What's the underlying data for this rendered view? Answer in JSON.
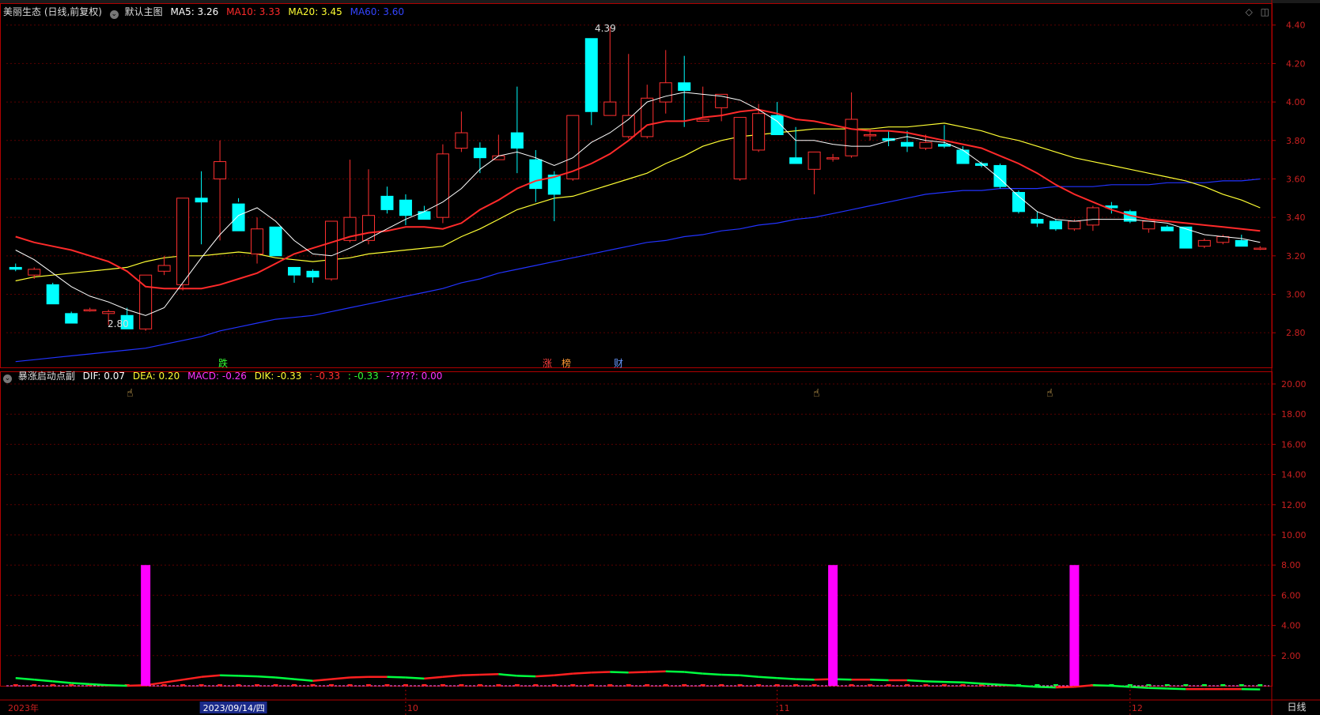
{
  "main_legend": {
    "title": "美丽生态 (日线,前复权)",
    "template": "默认主图",
    "ma5": {
      "label": "MA5: 3.26",
      "color": "#ffffff"
    },
    "ma10": {
      "label": "MA10: 3.33",
      "color": "#ff2a2a"
    },
    "ma20": {
      "label": "MA20: 3.45",
      "color": "#ffff33"
    },
    "ma60": {
      "label": "MA60: 3.60",
      "color": "#2233ff"
    }
  },
  "indicator_legend": {
    "name": "暴涨启动点副",
    "dif": "DIF: 0.07",
    "dea": "DEA: 0.20",
    "macd": "MACD: -0.26",
    "dik": "DIK: -0.33",
    "dik2": ": -0.33",
    "dik3": ": -0.33",
    "unk": "-?????: 0.00"
  },
  "markers": {
    "fall": "跌",
    "rise": "涨",
    "list": "榜",
    "finance": "财"
  },
  "annotations": {
    "high": "4.39",
    "low": "2.80"
  },
  "period_button": "日线",
  "colors": {
    "up": "#ff3030",
    "down": "#00ffff",
    "grid": "#5a0000",
    "axis": "#b00000",
    "signal": "#ff00ff"
  },
  "price_axis": {
    "ticks": [
      "4.40",
      "4.20",
      "4.00",
      "3.80",
      "3.60",
      "3.40",
      "3.20",
      "3.00",
      "2.80"
    ],
    "min": 2.62,
    "max": 4.44
  },
  "indicator_axis": {
    "ticks": [
      "20.00",
      "18.00",
      "16.00",
      "14.00",
      "12.00",
      "10.00",
      "8.00",
      "6.00",
      "4.00",
      "2.00"
    ],
    "min": 0,
    "max": 20
  },
  "time_axis": {
    "labels": [
      "2023年",
      "2023/09/14/四",
      "10",
      "11",
      "12"
    ]
  },
  "chart_data": {
    "type": "candlestick",
    "ohlc": [
      [
        3.14,
        3.16,
        3.12,
        3.13
      ],
      [
        3.1,
        3.14,
        3.08,
        3.13
      ],
      [
        3.05,
        3.06,
        2.96,
        2.95
      ],
      [
        2.9,
        2.91,
        2.86,
        2.85
      ],
      [
        2.92,
        2.93,
        2.91,
        2.92
      ],
      [
        2.9,
        2.92,
        2.84,
        2.91
      ],
      [
        2.89,
        2.93,
        2.82,
        2.82
      ],
      [
        2.82,
        3.1,
        2.81,
        3.1
      ],
      [
        3.12,
        3.2,
        3.1,
        3.15
      ],
      [
        3.05,
        3.5,
        3.02,
        3.5
      ],
      [
        3.5,
        3.64,
        3.26,
        3.48
      ],
      [
        3.6,
        3.8,
        3.28,
        3.69
      ],
      [
        3.47,
        3.5,
        3.48,
        3.33
      ],
      [
        3.21,
        3.4,
        3.16,
        3.34
      ],
      [
        3.35,
        3.35,
        3.2,
        3.2
      ],
      [
        3.14,
        3.14,
        3.06,
        3.1
      ],
      [
        3.12,
        3.13,
        3.06,
        3.09
      ],
      [
        3.08,
        3.38,
        3.07,
        3.38
      ],
      [
        3.28,
        3.7,
        3.27,
        3.4
      ],
      [
        3.28,
        3.65,
        3.26,
        3.41
      ],
      [
        3.51,
        3.56,
        3.42,
        3.44
      ],
      [
        3.49,
        3.52,
        3.36,
        3.41
      ],
      [
        3.43,
        3.46,
        3.39,
        3.39
      ],
      [
        3.4,
        3.78,
        3.37,
        3.73
      ],
      [
        3.76,
        3.95,
        3.74,
        3.84
      ],
      [
        3.76,
        3.79,
        3.63,
        3.71
      ],
      [
        3.7,
        3.83,
        3.7,
        3.72
      ],
      [
        3.84,
        4.08,
        3.63,
        3.76
      ],
      [
        3.7,
        3.75,
        3.48,
        3.55
      ],
      [
        3.62,
        3.64,
        3.38,
        3.52
      ],
      [
        3.6,
        3.92,
        3.59,
        3.93
      ],
      [
        4.33,
        4.33,
        3.88,
        3.95
      ],
      [
        3.93,
        4.39,
        3.99,
        4.0
      ],
      [
        3.82,
        4.25,
        3.81,
        3.93
      ],
      [
        3.82,
        4.09,
        3.81,
        4.02
      ],
      [
        4.0,
        4.27,
        3.94,
        4.1
      ],
      [
        4.1,
        4.24,
        3.87,
        4.06
      ],
      [
        3.9,
        4.08,
        3.92,
        3.91
      ],
      [
        3.97,
        4.03,
        3.9,
        4.04
      ],
      [
        3.6,
        3.89,
        3.59,
        3.92
      ],
      [
        3.75,
        3.99,
        3.74,
        3.94
      ],
      [
        3.93,
        4.0,
        3.86,
        3.83
      ],
      [
        3.71,
        3.87,
        3.68,
        3.68
      ],
      [
        3.65,
        3.72,
        3.52,
        3.74
      ],
      [
        3.71,
        3.73,
        3.69,
        3.71
      ],
      [
        3.72,
        4.05,
        3.71,
        3.91
      ],
      [
        3.83,
        3.86,
        3.8,
        3.83
      ],
      [
        3.81,
        3.85,
        3.77,
        3.8
      ],
      [
        3.79,
        3.85,
        3.74,
        3.77
      ],
      [
        3.76,
        3.83,
        3.75,
        3.79
      ],
      [
        3.78,
        3.88,
        3.76,
        3.77
      ],
      [
        3.75,
        3.77,
        3.68,
        3.68
      ],
      [
        3.68,
        3.69,
        3.66,
        3.67
      ],
      [
        3.67,
        3.68,
        3.55,
        3.56
      ],
      [
        3.53,
        3.54,
        3.42,
        3.43
      ],
      [
        3.39,
        3.43,
        3.35,
        3.37
      ],
      [
        3.38,
        3.39,
        3.33,
        3.34
      ],
      [
        3.34,
        3.39,
        3.33,
        3.38
      ],
      [
        3.36,
        3.46,
        3.33,
        3.45
      ],
      [
        3.46,
        3.48,
        3.42,
        3.45
      ],
      [
        3.43,
        3.44,
        3.37,
        3.38
      ],
      [
        3.34,
        3.38,
        3.32,
        3.38
      ],
      [
        3.35,
        3.36,
        3.33,
        3.33
      ],
      [
        3.35,
        3.35,
        3.24,
        3.24
      ],
      [
        3.25,
        3.29,
        3.24,
        3.28
      ],
      [
        3.27,
        3.31,
        3.26,
        3.3
      ],
      [
        3.28,
        3.31,
        3.25,
        3.25
      ],
      [
        3.24,
        3.25,
        3.23,
        3.24
      ]
    ],
    "ma5": [
      3.23,
      3.18,
      3.11,
      3.04,
      2.99,
      2.96,
      2.92,
      2.89,
      2.93,
      3.06,
      3.19,
      3.31,
      3.41,
      3.45,
      3.38,
      3.28,
      3.21,
      3.2,
      3.24,
      3.29,
      3.34,
      3.39,
      3.43,
      3.48,
      3.55,
      3.65,
      3.72,
      3.74,
      3.71,
      3.67,
      3.71,
      3.79,
      3.84,
      3.91,
      4.0,
      4.03,
      4.05,
      4.04,
      4.03,
      4.01,
      3.96,
      3.9,
      3.8,
      3.8,
      3.78,
      3.77,
      3.77,
      3.8,
      3.82,
      3.8,
      3.79,
      3.75,
      3.68,
      3.6,
      3.51,
      3.43,
      3.39,
      3.38,
      3.39,
      3.39,
      3.39,
      3.38,
      3.37,
      3.34,
      3.31,
      3.3,
      3.29,
      3.27
    ],
    "ma10": [
      3.3,
      3.27,
      3.25,
      3.23,
      3.2,
      3.17,
      3.12,
      3.04,
      3.03,
      3.03,
      3.03,
      3.05,
      3.08,
      3.11,
      3.16,
      3.21,
      3.24,
      3.27,
      3.3,
      3.32,
      3.33,
      3.35,
      3.35,
      3.34,
      3.37,
      3.44,
      3.49,
      3.55,
      3.59,
      3.61,
      3.64,
      3.68,
      3.73,
      3.8,
      3.88,
      3.9,
      3.9,
      3.92,
      3.93,
      3.95,
      3.96,
      3.94,
      3.91,
      3.9,
      3.88,
      3.86,
      3.85,
      3.85,
      3.84,
      3.82,
      3.8,
      3.78,
      3.76,
      3.72,
      3.68,
      3.63,
      3.57,
      3.52,
      3.48,
      3.44,
      3.41,
      3.39,
      3.38,
      3.37,
      3.36,
      3.35,
      3.34,
      3.33
    ],
    "ma20": [
      3.07,
      3.09,
      3.1,
      3.11,
      3.12,
      3.13,
      3.14,
      3.17,
      3.19,
      3.2,
      3.2,
      3.21,
      3.22,
      3.21,
      3.19,
      3.18,
      3.17,
      3.18,
      3.19,
      3.21,
      3.22,
      3.23,
      3.24,
      3.25,
      3.3,
      3.34,
      3.39,
      3.44,
      3.47,
      3.5,
      3.51,
      3.54,
      3.57,
      3.6,
      3.63,
      3.68,
      3.72,
      3.77,
      3.8,
      3.82,
      3.83,
      3.84,
      3.85,
      3.86,
      3.86,
      3.86,
      3.86,
      3.87,
      3.87,
      3.88,
      3.89,
      3.87,
      3.85,
      3.82,
      3.8,
      3.77,
      3.74,
      3.71,
      3.69,
      3.67,
      3.65,
      3.63,
      3.61,
      3.59,
      3.56,
      3.52,
      3.49,
      3.45
    ],
    "ma60": [
      2.65,
      2.66,
      2.67,
      2.68,
      2.69,
      2.7,
      2.71,
      2.72,
      2.74,
      2.76,
      2.78,
      2.81,
      2.83,
      2.85,
      2.87,
      2.88,
      2.89,
      2.91,
      2.93,
      2.95,
      2.97,
      2.99,
      3.01,
      3.03,
      3.06,
      3.08,
      3.11,
      3.13,
      3.15,
      3.17,
      3.19,
      3.21,
      3.23,
      3.25,
      3.27,
      3.28,
      3.3,
      3.31,
      3.33,
      3.34,
      3.36,
      3.37,
      3.39,
      3.4,
      3.42,
      3.44,
      3.46,
      3.48,
      3.5,
      3.52,
      3.53,
      3.54,
      3.54,
      3.55,
      3.55,
      3.55,
      3.56,
      3.56,
      3.56,
      3.57,
      3.57,
      3.57,
      3.58,
      3.58,
      3.58,
      3.59,
      3.59,
      3.6
    ],
    "signal_bars": [
      {
        "index": 7,
        "value": 8
      },
      {
        "index": 44,
        "value": 8
      },
      {
        "index": 57,
        "value": 8
      }
    ],
    "indicator_line": [
      0.7,
      0.55,
      0.4,
      0.25,
      0.15,
      0.05,
      0.0,
      0.05,
      0.3,
      0.55,
      0.8,
      0.95,
      0.9,
      0.85,
      0.75,
      0.6,
      0.45,
      0.6,
      0.75,
      0.8,
      0.8,
      0.75,
      0.65,
      0.8,
      0.95,
      1.0,
      1.05,
      0.9,
      0.85,
      0.95,
      1.1,
      1.2,
      1.25,
      1.2,
      1.25,
      1.3,
      1.25,
      1.1,
      1.0,
      0.95,
      0.8,
      0.7,
      0.6,
      0.55,
      0.6,
      0.55,
      0.55,
      0.5,
      0.5,
      0.4,
      0.35,
      0.3,
      0.2,
      0.1,
      0.0,
      -0.1,
      -0.15,
      -0.1,
      0.05,
      0.0,
      -0.1,
      -0.2,
      -0.25,
      -0.3,
      -0.3,
      -0.3,
      -0.3,
      -0.33
    ],
    "macd_bars": [
      0.1,
      0.15,
      0.12,
      0.08,
      0.05,
      0.03,
      0.01,
      0.02,
      0.05,
      0.08,
      0.12,
      0.15,
      0.18,
      0.14,
      0.1,
      0.06,
      0.12,
      0.16,
      0.2,
      0.22,
      0.22,
      0.2,
      0.18,
      0.22,
      0.24,
      0.25,
      0.26,
      0.24,
      0.18,
      0.2,
      0.22,
      0.26,
      0.3,
      0.28,
      0.27,
      0.26,
      0.22,
      0.2,
      0.18,
      0.15,
      0.12,
      0.1,
      0.08,
      0.06,
      0.1,
      0.12,
      0.15,
      0.2,
      0.18,
      0.15,
      0.12,
      0.08,
      0.04,
      -0.02,
      -0.06,
      -0.1,
      -0.12,
      -0.1,
      -0.08,
      -0.1,
      -0.14,
      -0.18,
      -0.2,
      -0.22,
      -0.24,
      -0.25,
      -0.26,
      -0.26
    ]
  }
}
